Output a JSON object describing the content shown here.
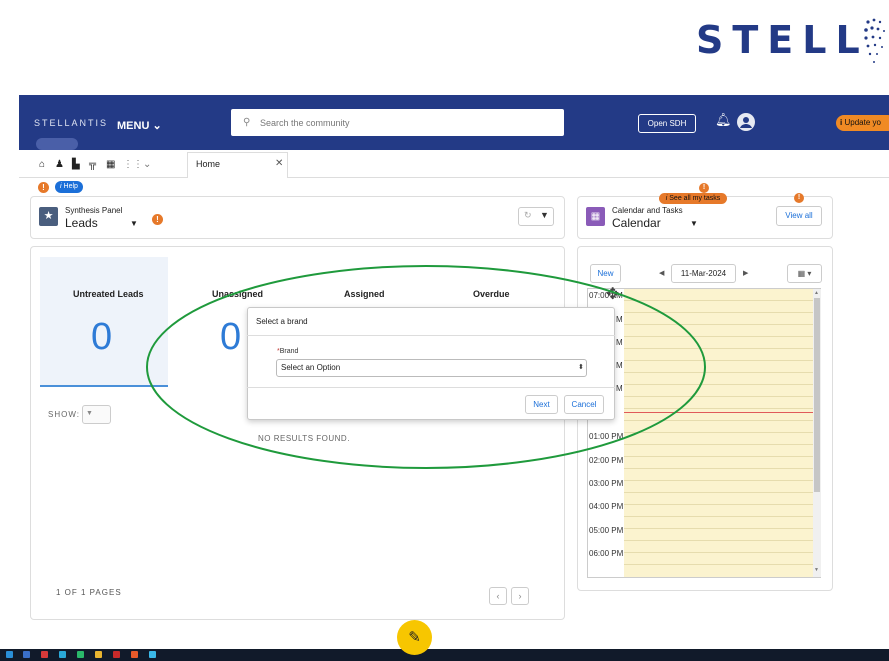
{
  "brandmark": "STELL",
  "nav": {
    "logo": "STELLANTIS",
    "menu": "MENU",
    "search_placeholder": "Search the community",
    "open_sdh": "Open SDH",
    "update": "Update yo"
  },
  "tabs": {
    "home": "Home"
  },
  "help": "Help",
  "synthesis": {
    "title": "Synthesis Panel",
    "selected": "Leads"
  },
  "calendar": {
    "title": "Calendar and Tasks",
    "selected": "Calendar",
    "view_all": "View all",
    "see_all_tasks": "See all my tasks",
    "new": "New",
    "date": "11-Mar-2024",
    "times": [
      "07:00 AM",
      "M",
      "M",
      "M",
      "M",
      "01:00 PM",
      "02:00 PM",
      "03:00 PM",
      "04:00 PM",
      "05:00 PM",
      "06:00 PM"
    ]
  },
  "leads": {
    "columns": [
      "Untreated Leads",
      "Unassigned",
      "Assigned",
      "Overdue"
    ],
    "counts": [
      "0",
      "0"
    ],
    "show_label": "SHOW:",
    "no_results": "NO RESULTS FOUND.",
    "pages": "1 OF 1 PAGES"
  },
  "modal": {
    "title": "Select a brand",
    "field_label": "Brand",
    "required_mark": "*",
    "select_value": "Select an Option",
    "next": "Next",
    "cancel": "Cancel"
  },
  "colors": {
    "navy": "#233a86",
    "accent": "#1b6fd8",
    "warning": "#e6792a",
    "highlight": "#1f9a3c"
  }
}
